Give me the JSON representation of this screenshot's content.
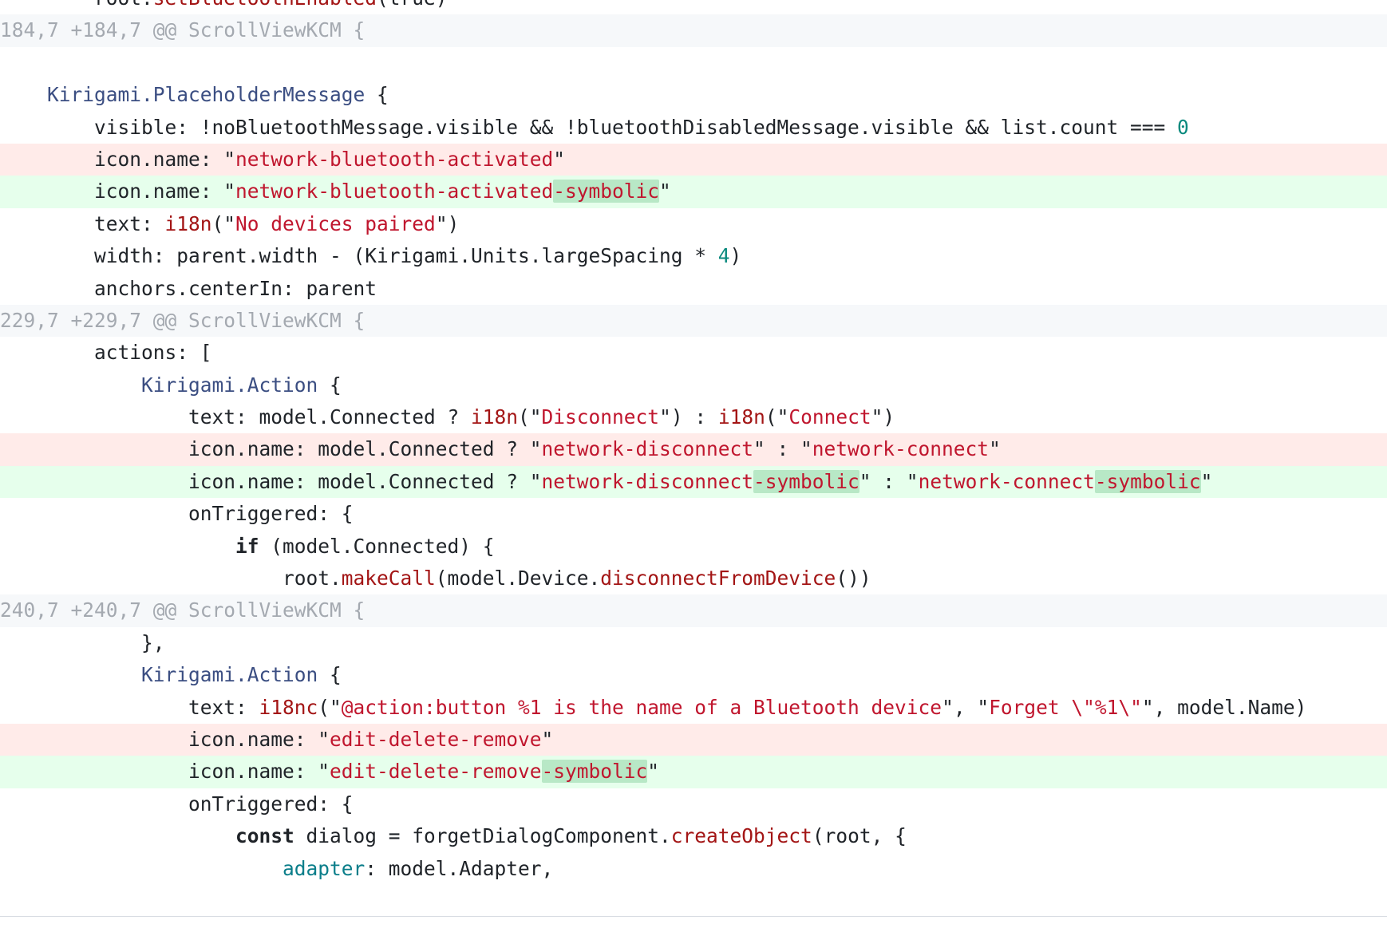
{
  "diff": {
    "lines": [
      {
        "type": "ctx",
        "tokens": [
          {
            "t": "        root.",
            "c": "punc"
          },
          {
            "t": "setBluetoothEnabled",
            "c": "fn"
          },
          {
            "t": "(true)",
            "c": "punc"
          }
        ]
      },
      {
        "type": "hunk",
        "tokens": [
          {
            "t": "@@ -184,7 +184,7 @@ ScrollViewKCM {",
            "c": ""
          }
        ]
      },
      {
        "type": "empty",
        "tokens": []
      },
      {
        "type": "ctx",
        "tokens": [
          {
            "t": "    ",
            "c": ""
          },
          {
            "t": "Kirigami.PlaceholderMessage",
            "c": "ty"
          },
          {
            "t": " {",
            "c": "punc"
          }
        ]
      },
      {
        "type": "ctx",
        "tokens": [
          {
            "t": "        visible: !noBluetoothMessage.visible && !bluetoothDisabledMessage.visible && list.count === ",
            "c": "punc"
          },
          {
            "t": "0",
            "c": "num"
          }
        ]
      },
      {
        "type": "del",
        "tokens": [
          {
            "t": "        icon.name: \"",
            "c": "punc"
          },
          {
            "t": "network-bluetooth-activated",
            "c": "str"
          },
          {
            "t": "\"",
            "c": "punc"
          }
        ]
      },
      {
        "type": "add",
        "tokens": [
          {
            "t": "        icon.name: \"",
            "c": "punc"
          },
          {
            "t": "network-bluetooth-activated",
            "c": "str"
          },
          {
            "t": "-symbolic",
            "c": "str hl"
          },
          {
            "t": "\"",
            "c": "punc"
          }
        ]
      },
      {
        "type": "ctx",
        "tokens": [
          {
            "t": "        text: ",
            "c": "punc"
          },
          {
            "t": "i18n",
            "c": "fn"
          },
          {
            "t": "(\"",
            "c": "punc"
          },
          {
            "t": "No devices paired",
            "c": "str"
          },
          {
            "t": "\")",
            "c": "punc"
          }
        ]
      },
      {
        "type": "ctx",
        "tokens": [
          {
            "t": "        width: parent.width - (Kirigami.Units.largeSpacing * ",
            "c": "punc"
          },
          {
            "t": "4",
            "c": "num"
          },
          {
            "t": ")",
            "c": "punc"
          }
        ]
      },
      {
        "type": "ctx",
        "tokens": [
          {
            "t": "        anchors.centerIn: parent",
            "c": "punc"
          }
        ]
      },
      {
        "type": "hunk",
        "tokens": [
          {
            "t": "@@ -229,7 +229,7 @@ ScrollViewKCM {",
            "c": ""
          }
        ]
      },
      {
        "type": "ctx",
        "tokens": [
          {
            "t": "        actions: [",
            "c": "punc"
          }
        ]
      },
      {
        "type": "ctx",
        "tokens": [
          {
            "t": "            ",
            "c": ""
          },
          {
            "t": "Kirigami.Action",
            "c": "ty"
          },
          {
            "t": " {",
            "c": "punc"
          }
        ]
      },
      {
        "type": "ctx",
        "tokens": [
          {
            "t": "                text: model.Connected ? ",
            "c": "punc"
          },
          {
            "t": "i18n",
            "c": "fn"
          },
          {
            "t": "(\"",
            "c": "punc"
          },
          {
            "t": "Disconnect",
            "c": "str"
          },
          {
            "t": "\") : ",
            "c": "punc"
          },
          {
            "t": "i18n",
            "c": "fn"
          },
          {
            "t": "(\"",
            "c": "punc"
          },
          {
            "t": "Connect",
            "c": "str"
          },
          {
            "t": "\")",
            "c": "punc"
          }
        ]
      },
      {
        "type": "del",
        "tokens": [
          {
            "t": "                icon.name: model.Connected ? \"",
            "c": "punc"
          },
          {
            "t": "network-disconnect",
            "c": "str"
          },
          {
            "t": "\" : \"",
            "c": "punc"
          },
          {
            "t": "network-connect",
            "c": "str"
          },
          {
            "t": "\"",
            "c": "punc"
          }
        ]
      },
      {
        "type": "add",
        "tokens": [
          {
            "t": "                icon.name: model.Connected ? \"",
            "c": "punc"
          },
          {
            "t": "network-disconnect",
            "c": "str"
          },
          {
            "t": "-symbolic",
            "c": "str hl"
          },
          {
            "t": "\" : \"",
            "c": "punc"
          },
          {
            "t": "network-connect",
            "c": "str"
          },
          {
            "t": "-symbolic",
            "c": "str hl"
          },
          {
            "t": "\"",
            "c": "punc"
          }
        ]
      },
      {
        "type": "ctx",
        "tokens": [
          {
            "t": "                onTriggered: {",
            "c": "punc"
          }
        ]
      },
      {
        "type": "ctx",
        "tokens": [
          {
            "t": "                    ",
            "c": ""
          },
          {
            "t": "if",
            "c": "kw"
          },
          {
            "t": " (model.Connected) {",
            "c": "punc"
          }
        ]
      },
      {
        "type": "ctx",
        "tokens": [
          {
            "t": "                        root.",
            "c": "punc"
          },
          {
            "t": "makeCall",
            "c": "fn"
          },
          {
            "t": "(model.Device.",
            "c": "punc"
          },
          {
            "t": "disconnectFromDevice",
            "c": "fn"
          },
          {
            "t": "())",
            "c": "punc"
          }
        ]
      },
      {
        "type": "hunk",
        "tokens": [
          {
            "t": "@@ -240,7 +240,7 @@ ScrollViewKCM {",
            "c": ""
          }
        ]
      },
      {
        "type": "ctx",
        "tokens": [
          {
            "t": "            },",
            "c": "punc"
          }
        ]
      },
      {
        "type": "ctx",
        "tokens": [
          {
            "t": "            ",
            "c": ""
          },
          {
            "t": "Kirigami.Action",
            "c": "ty"
          },
          {
            "t": " {",
            "c": "punc"
          }
        ]
      },
      {
        "type": "ctx",
        "tokens": [
          {
            "t": "                text: ",
            "c": "punc"
          },
          {
            "t": "i18nc",
            "c": "fn"
          },
          {
            "t": "(\"",
            "c": "punc"
          },
          {
            "t": "@action:button %1 is the name of a Bluetooth device",
            "c": "str"
          },
          {
            "t": "\", \"",
            "c": "punc"
          },
          {
            "t": "Forget \\\"%1\\\"",
            "c": "str"
          },
          {
            "t": "\", model.Name)",
            "c": "punc"
          }
        ]
      },
      {
        "type": "del",
        "tokens": [
          {
            "t": "                icon.name: \"",
            "c": "punc"
          },
          {
            "t": "edit-delete-remove",
            "c": "str"
          },
          {
            "t": "\"",
            "c": "punc"
          }
        ]
      },
      {
        "type": "add",
        "tokens": [
          {
            "t": "                icon.name: \"",
            "c": "punc"
          },
          {
            "t": "edit-delete-remove",
            "c": "str"
          },
          {
            "t": "-symbolic",
            "c": "str hl"
          },
          {
            "t": "\"",
            "c": "punc"
          }
        ]
      },
      {
        "type": "ctx",
        "tokens": [
          {
            "t": "                onTriggered: {",
            "c": "punc"
          }
        ]
      },
      {
        "type": "ctx",
        "tokens": [
          {
            "t": "                    ",
            "c": ""
          },
          {
            "t": "const",
            "c": "kw"
          },
          {
            "t": " dialog = forgetDialogComponent.",
            "c": "punc"
          },
          {
            "t": "createObject",
            "c": "fn"
          },
          {
            "t": "(root, {",
            "c": "punc"
          }
        ]
      },
      {
        "type": "ctx",
        "tokens": [
          {
            "t": "                        ",
            "c": ""
          },
          {
            "t": "adapter",
            "c": "prop"
          },
          {
            "t": ": model.Adapter,",
            "c": "punc"
          }
        ]
      }
    ]
  }
}
